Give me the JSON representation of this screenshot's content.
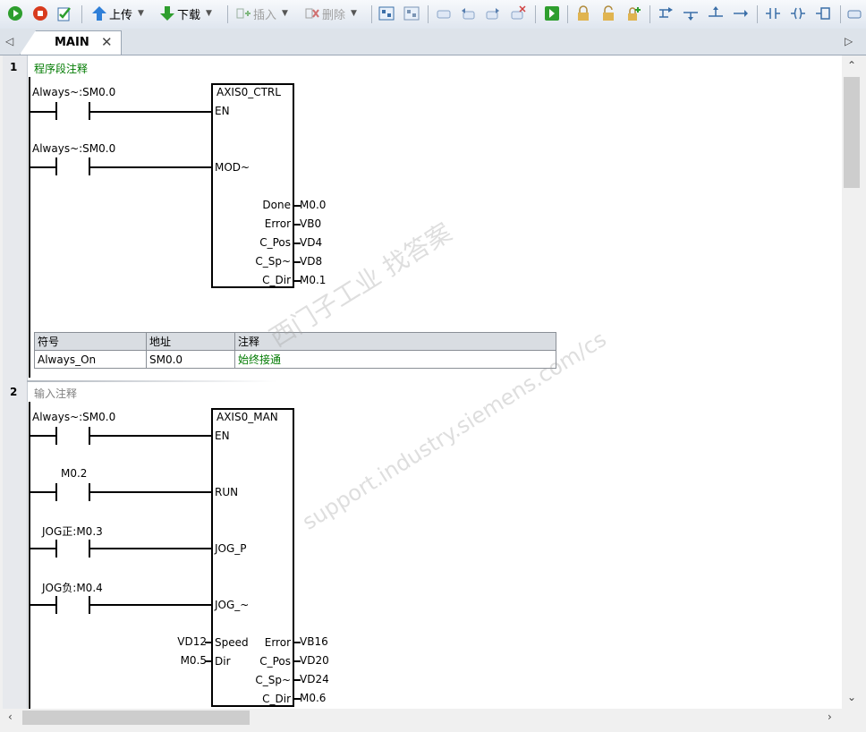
{
  "toolbar": {
    "upload_label": "上传",
    "download_label": "下载",
    "insert_label": "插入",
    "delete_label": "删除"
  },
  "tabs": [
    {
      "label": "MAIN"
    }
  ],
  "networks": [
    {
      "number": "1",
      "comment": "程序段注释",
      "block": {
        "title": "AXIS0_CTRL",
        "inputs": [
          {
            "contact_label": "Always~:SM0.0",
            "pin": "EN"
          },
          {
            "contact_label": "Always~:SM0.0",
            "pin": "MOD~"
          }
        ],
        "outputs": [
          {
            "pin": "Done",
            "value": "M0.0"
          },
          {
            "pin": "Error",
            "value": "VB0"
          },
          {
            "pin": "C_Pos",
            "value": "VD4"
          },
          {
            "pin": "C_Sp~",
            "value": "VD8"
          },
          {
            "pin": "C_Dir",
            "value": "M0.1"
          }
        ]
      },
      "symbol_table": {
        "headers": [
          "符号",
          "地址",
          "注释"
        ],
        "rows": [
          [
            "Always_On",
            "SM0.0",
            "始终接通"
          ]
        ]
      }
    },
    {
      "number": "2",
      "comment": "输入注释",
      "block": {
        "title": "AXIS0_MAN",
        "inputs": [
          {
            "contact_label": "Always~:SM0.0",
            "pin": "EN"
          },
          {
            "contact_label": "M0.2",
            "pin": "RUN"
          },
          {
            "contact_label": "JOG正:M0.3",
            "pin": "JOG_P"
          },
          {
            "contact_label": "JOG负:M0.4",
            "pin": "JOG_~"
          }
        ],
        "value_inputs": [
          {
            "value": "VD12",
            "pin": "Speed"
          },
          {
            "value": "M0.5",
            "pin": "Dir"
          }
        ],
        "outputs": [
          {
            "pin": "Error",
            "value": "VB16"
          },
          {
            "pin": "C_Pos",
            "value": "VD20"
          },
          {
            "pin": "C_Sp~",
            "value": "VD24"
          },
          {
            "pin": "C_Dir",
            "value": "M0.6"
          }
        ]
      }
    }
  ],
  "watermark": {
    "line1": "西门子工业  找答案",
    "line2": "support.industry.siemens.com/cs"
  },
  "colors": {
    "comment_green": "#007a00",
    "comment_gray": "#808080"
  }
}
